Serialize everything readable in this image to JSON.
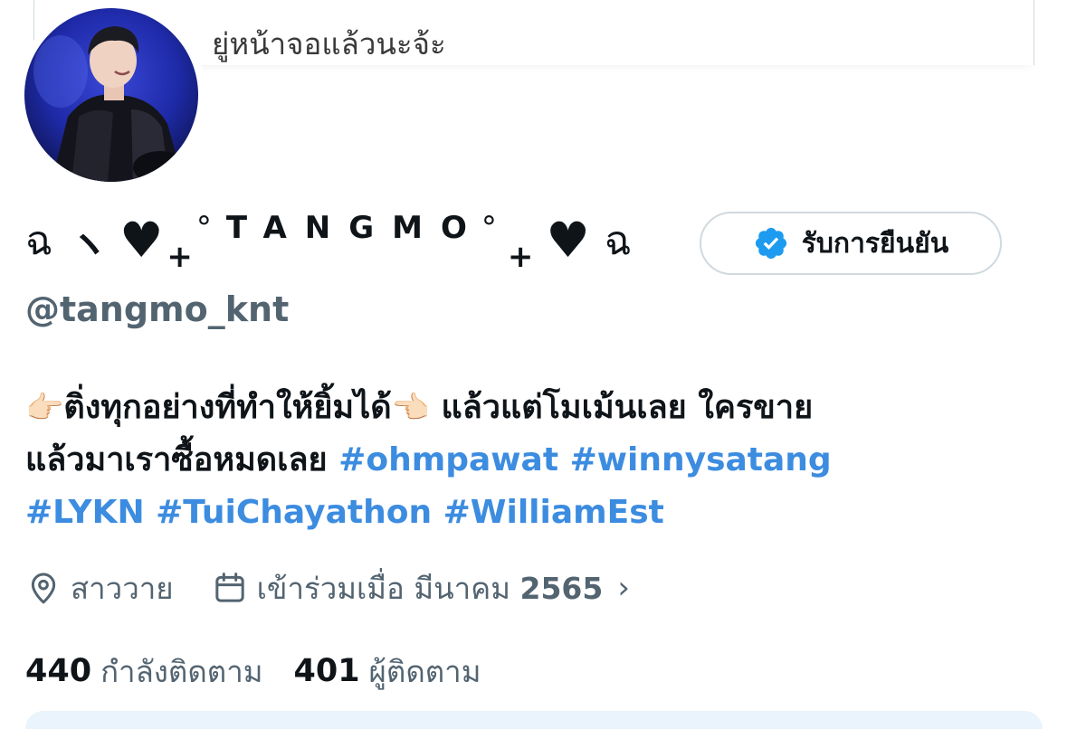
{
  "banner": {
    "text": "ยู่หน้าจอแล้วนะจ้ะ"
  },
  "profile": {
    "name_left_glyph": "ฉ",
    "name_slash": "ヽ",
    "name_heart": "♥",
    "name_plus": "+",
    "name_ring": "°",
    "name_text": "TANGMO",
    "name_ring_2": "°",
    "name_plus_2": "+",
    "name_heart_2": "♥",
    "name_right_glyph": "ฉ",
    "verify_label": "รับการยืนยัน",
    "handle": "@tangmo_knt"
  },
  "bio": {
    "line1_emoji_left": "👉🏻",
    "line1_text": "ติ่งทุกอย่างที่ทำให้ยิ้มได้",
    "line1_emoji_right": "👈🏻",
    "line1_text2": " แล้วแต่โมเม้นเลย ใครขาย",
    "line2_text": "แล้วมาเราซื้อหมดเลย ",
    "hashtags_line2": [
      "#ohmpawat",
      "#winnysatang"
    ],
    "hashtags_line3": [
      "#LYKN",
      "#TuiChayathon",
      "#WilliamEst"
    ]
  },
  "meta": {
    "location": "สาววาย",
    "joined_prefix": "เข้าร่วมเมื่อ มีนาคม",
    "joined_year": "2565",
    "chevron": "›",
    "location_icon": "location-pin-icon",
    "calendar_icon": "calendar-icon"
  },
  "follow": {
    "following_count": "440",
    "following_label": "กำลังติดตาม",
    "followers_count": "401",
    "followers_label": "ผู้ติดตาม"
  },
  "colors": {
    "hashtag": "#3c8ce0",
    "secondary_text": "#536471",
    "verify_badge": "#1d9bf0",
    "border": "#cfd9de"
  }
}
